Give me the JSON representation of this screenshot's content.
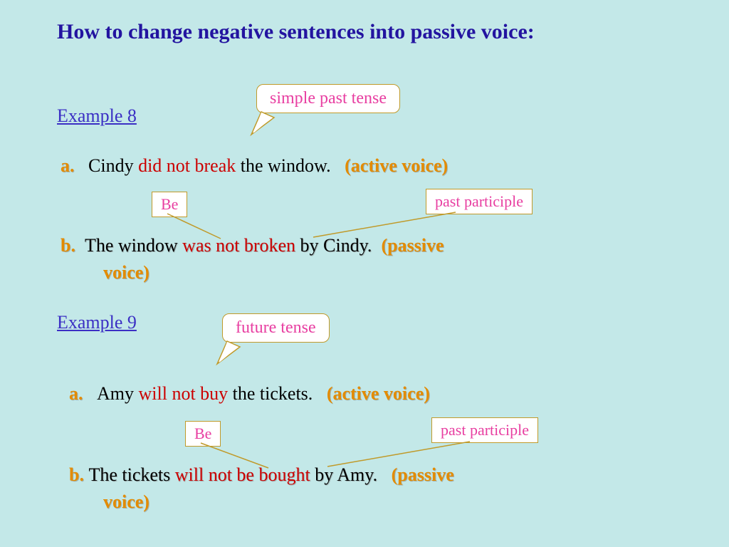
{
  "title": "How to change negative sentences into passive voice:",
  "ex8": {
    "heading": "Example 8",
    "callout": "simple past tense",
    "a": {
      "letter": "a.",
      "t1": "Cindy",
      "t2": "did not break",
      "t3": "the window.",
      "voice": "(active voice)"
    },
    "be_box": "Be",
    "pp_box": "past participle",
    "b": {
      "letter": "b.",
      "t1": "The window",
      "t2": "was not",
      "t3": "broken",
      "t4": "by Cindy.",
      "voice": "(passive",
      "voice2": "voice)"
    }
  },
  "ex9": {
    "heading": "Example 9",
    "callout": "future tense",
    "a": {
      "letter": "a.",
      "t1": "Amy",
      "t2": "will not buy",
      "t3": "the tickets.",
      "voice": "(active voice)"
    },
    "be_box": "Be",
    "pp_box": "past participle",
    "b": {
      "letter": "b.",
      "t1": "The tickets",
      "t2": "will not be",
      "t3": "bought",
      "t4": "by Amy.",
      "voice": "(passive",
      "voice2": "voice)"
    }
  }
}
